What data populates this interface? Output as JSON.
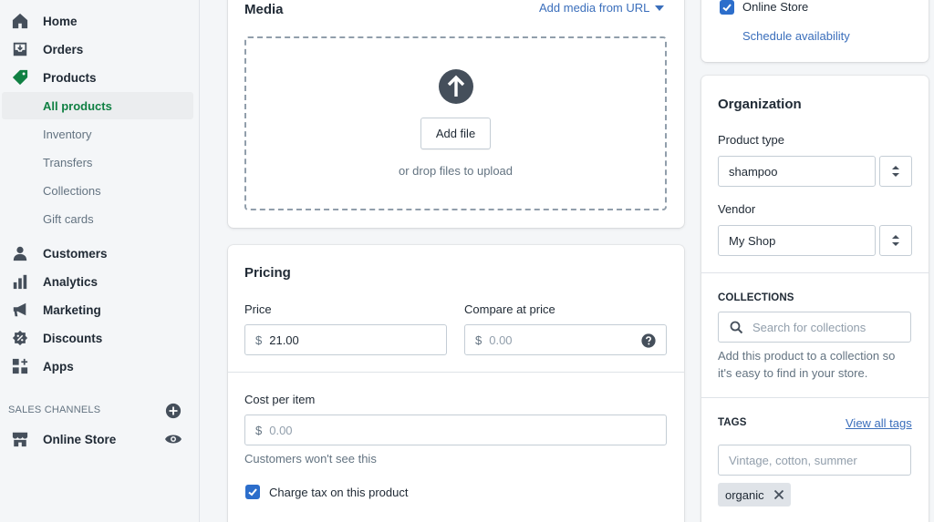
{
  "nav": {
    "home": "Home",
    "orders": "Orders",
    "products": "Products",
    "sub": [
      "All products",
      "Inventory",
      "Transfers",
      "Collections",
      "Gift cards"
    ],
    "customers": "Customers",
    "analytics": "Analytics",
    "marketing": "Marketing",
    "discounts": "Discounts",
    "apps": "Apps",
    "sales_channels": "SALES CHANNELS",
    "online_store": "Online Store"
  },
  "media": {
    "title": "Media",
    "add_url": "Add media from URL",
    "add_file": "Add file",
    "drop_hint": "or drop files to upload"
  },
  "pricing": {
    "title": "Pricing",
    "price_label": "Price",
    "currency": "$",
    "price_value": "21.00",
    "compare_label": "Compare at price",
    "compare_placeholder": "0.00",
    "cost_label": "Cost per item",
    "cost_placeholder": "0.00",
    "cost_help": "Customers won't see this",
    "tax_label": "Charge tax on this product",
    "tax_checked": true
  },
  "availability": {
    "online_store": "Online Store",
    "online_checked": true,
    "schedule": "Schedule availability"
  },
  "organization": {
    "title": "Organization",
    "product_type_label": "Product type",
    "product_type_value": "shampoo",
    "vendor_label": "Vendor",
    "vendor_value": "My Shop",
    "collections_title": "COLLECTIONS",
    "collections_placeholder": "Search for collections",
    "collections_help": [
      "Add this product to a collection so",
      "it's easy to find in your store."
    ],
    "tags_title": "TAGS",
    "view_all_tags": "View all tags",
    "tags_placeholder": "Vintage, cotton, summer",
    "tags": [
      "organic"
    ]
  },
  "colors": {
    "active_green": "#108043",
    "link_blue": "#3a6ebb",
    "checkbox_blue": "#2c6ecb"
  }
}
